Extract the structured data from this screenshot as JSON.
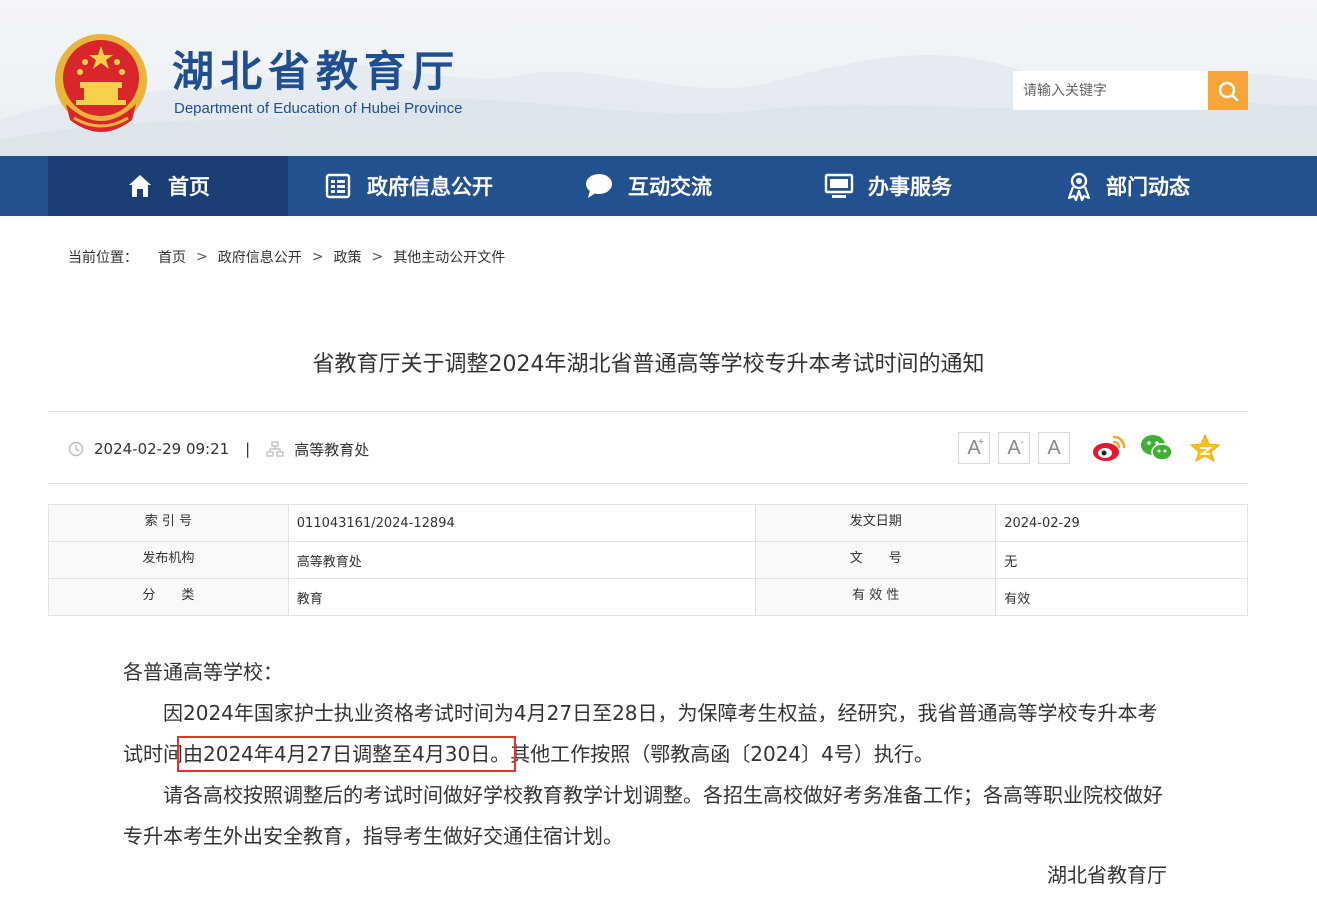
{
  "header": {
    "title": "湖北省教育厅",
    "subtitle": "Department of Education of Hubei Province",
    "search": {
      "placeholder": "请输入关键字",
      "value": ""
    }
  },
  "nav": {
    "items": [
      {
        "label": "首页",
        "icon": "home-icon",
        "active": true
      },
      {
        "label": "政府信息公开",
        "icon": "document-list-icon",
        "active": false
      },
      {
        "label": "互动交流",
        "icon": "chat-bubble-icon",
        "active": false
      },
      {
        "label": "办事服务",
        "icon": "monitor-icon",
        "active": false
      },
      {
        "label": "部门动态",
        "icon": "person-badge-icon",
        "active": false
      }
    ]
  },
  "breadcrumb": {
    "label": "当前位置：",
    "separator": ">",
    "items": [
      "首页",
      "政府信息公开",
      "政策",
      "其他主动公开文件"
    ]
  },
  "article": {
    "title": "省教育厅关于调整2024年湖北省普通高等学校专升本考试时间的通知",
    "datetime": "2024-02-29 09:21",
    "meta_divider": "|",
    "department": "高等教育处",
    "font_controls": {
      "increase": "A",
      "increase_mark": "+",
      "decrease": "A",
      "decrease_mark": "-",
      "reset": "A"
    }
  },
  "info_table": {
    "rows": [
      {
        "k1": "索 引 号",
        "v1": "011043161/2024-12894",
        "k2": "发文日期",
        "v2": "2024-02-29"
      },
      {
        "k1": "发布机构",
        "v1": "高等教育处",
        "k2": "文　　号",
        "v2": "无"
      },
      {
        "k1": "分　　类",
        "v1": "教育",
        "k2": "有 效 性",
        "v2": "有效"
      }
    ]
  },
  "body": {
    "salutation": "各普通高等学校：",
    "p1_before": "因2024年国家护士执业资格考试时间为4月27日至28日，为保障考生权益，经研究，我省普通高等学校专升本考试时间",
    "p1_highlight": "由2024年4月27日调整至4月30日。",
    "p1_after": "其他工作按照（鄂教高函〔2024〕4号）执行。",
    "p2": "请各高校按照调整后的考试时间做好学校教育教学计划调整。各招生高校做好考务准备工作；各高等职业院校做好专升本考生外出安全教育，指导考生做好交通住宿计划。",
    "signature": "湖北省教育厅"
  },
  "colors": {
    "brand_blue": "#23508f",
    "nav_active": "#1b3f74",
    "search_button": "#f6a53a",
    "highlight_box": "#e5322d"
  }
}
